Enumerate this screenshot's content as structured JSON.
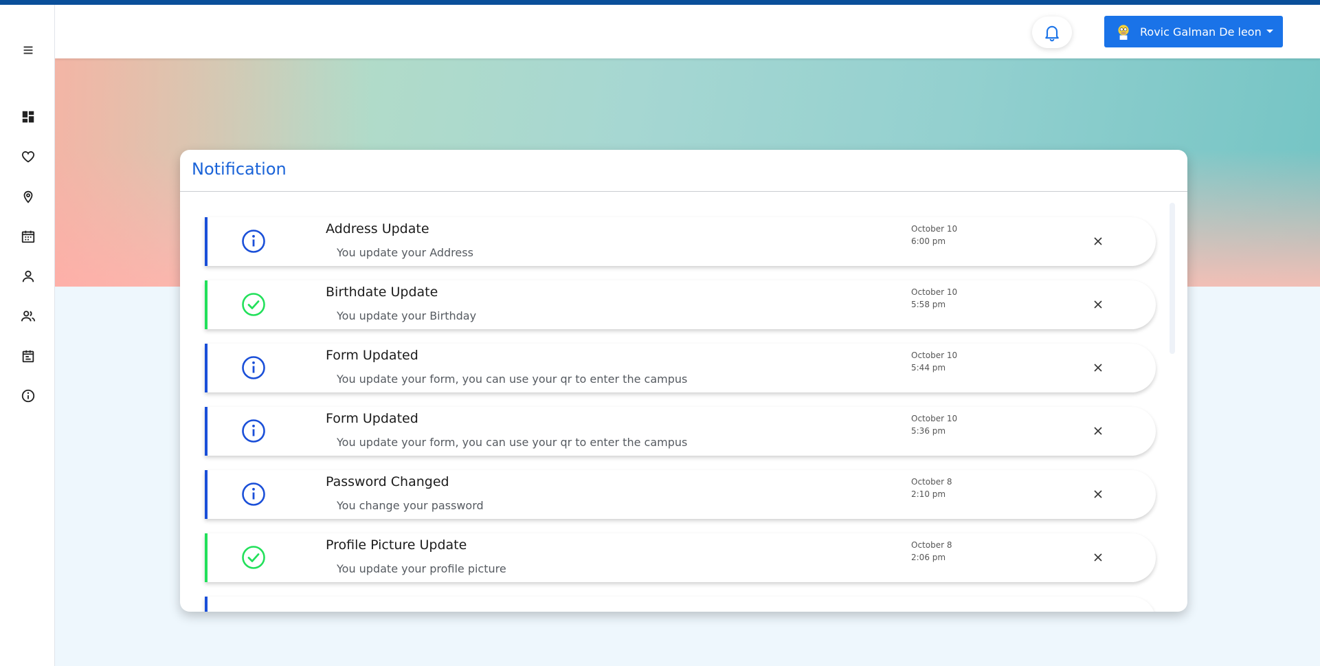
{
  "header": {
    "user_name": "Rovic Galman De leon"
  },
  "sidebar": {
    "items": [
      {
        "icon": "menu-icon"
      },
      {
        "icon": "dashboard-icon"
      },
      {
        "icon": "heart-icon"
      },
      {
        "icon": "location-pin-icon"
      },
      {
        "icon": "calendar-icon"
      },
      {
        "icon": "user-icon"
      },
      {
        "icon": "users-icon"
      },
      {
        "icon": "schedule-icon"
      },
      {
        "icon": "info-icon"
      }
    ]
  },
  "card": {
    "title": "Notification"
  },
  "notifications": [
    {
      "type": "info",
      "title": "Address Update",
      "desc": "You update your Address",
      "date": "October 10",
      "time": "6:00 pm"
    },
    {
      "type": "success",
      "title": "Birthdate Update",
      "desc": "You update your Birthday",
      "date": "October 10",
      "time": "5:58 pm"
    },
    {
      "type": "info",
      "title": "Form Updated",
      "desc": "You update your form, you can use your qr to enter the campus",
      "date": "October 10",
      "time": "5:44 pm"
    },
    {
      "type": "info",
      "title": "Form Updated",
      "desc": "You update your form, you can use your qr to enter the campus",
      "date": "October 10",
      "time": "5:36 pm"
    },
    {
      "type": "info",
      "title": "Password Changed",
      "desc": "You change your password",
      "date": "October 8",
      "time": "2:10 pm"
    },
    {
      "type": "success",
      "title": "Profile Picture Update",
      "desc": "You update your profile picture",
      "date": "October 8",
      "time": "2:06 pm"
    }
  ],
  "colors": {
    "primary": "#1a73e8",
    "info": "#1a4fd8",
    "success": "#22e05a",
    "title": "#1a63d8"
  }
}
